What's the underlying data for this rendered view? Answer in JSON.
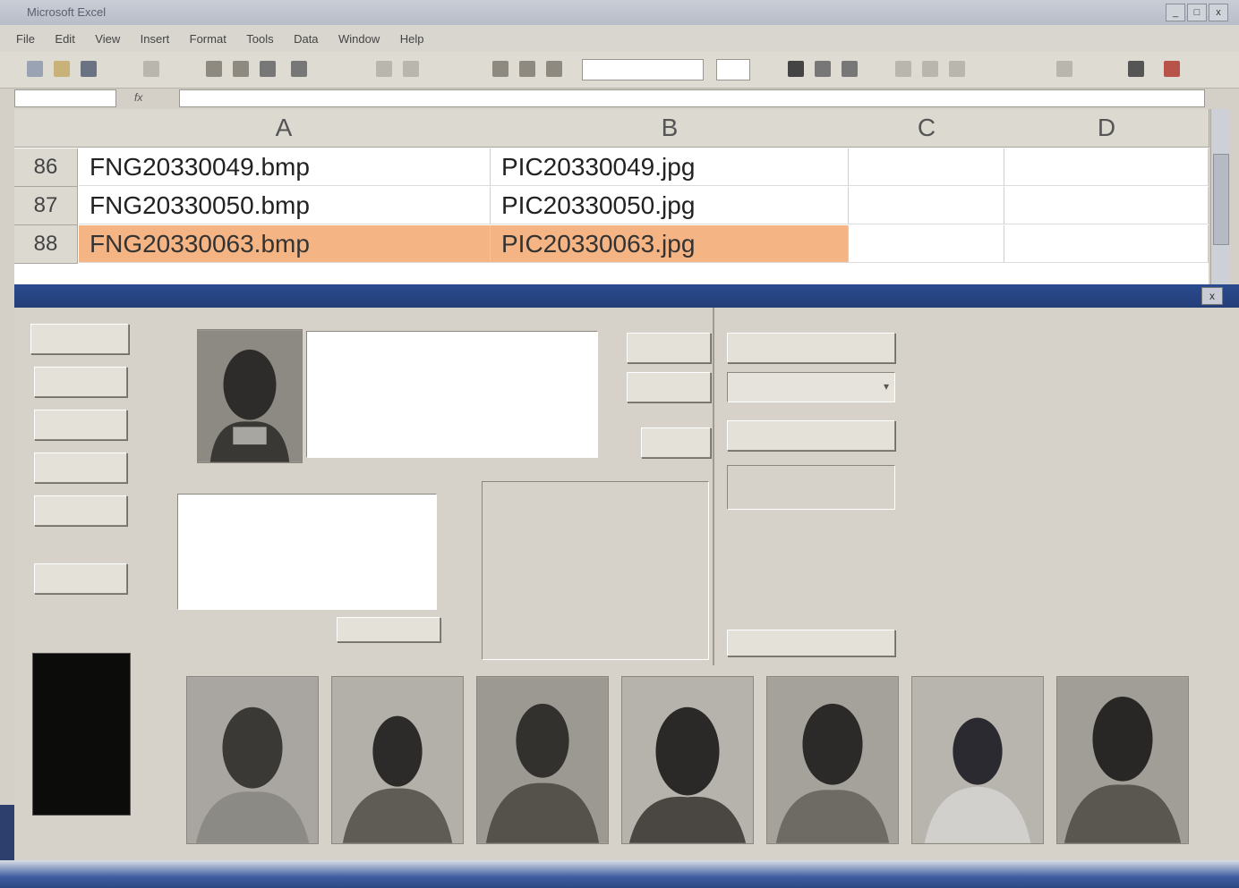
{
  "excel": {
    "window_title": "Microsoft Excel",
    "menu": [
      "File",
      "Edit",
      "View",
      "Insert",
      "Format",
      "Tools",
      "Data",
      "Window",
      "Help"
    ],
    "font_name": "",
    "font_size": "",
    "name_box": "",
    "fx": "fx",
    "formula": "",
    "columns": [
      "A",
      "B",
      "C",
      "D"
    ],
    "rows": [
      {
        "num": "86",
        "a": "FNG20330049.bmp",
        "b": "PIC20330049.jpg",
        "highlight": false
      },
      {
        "num": "87",
        "a": "FNG20330050.bmp",
        "b": "PIC20330050.jpg",
        "highlight": false
      },
      {
        "num": "88",
        "a": "FNG20330063.bmp",
        "b": "PIC20330063.jpg",
        "highlight": true
      }
    ],
    "highlight_color": "#f4b483"
  },
  "app": {
    "window_title": "",
    "close_label": "x",
    "left_buttons": [
      "",
      "",
      "",
      "",
      "",
      ""
    ],
    "top_buttons": [
      "",
      "",
      ""
    ],
    "right_buttons": [
      "",
      "",
      ""
    ],
    "small_label": "",
    "list_first_item": "",
    "bottom_label": "",
    "bottom_button": "",
    "bottom_right_button": "",
    "info_panel_lines": [
      "",
      "",
      ""
    ],
    "thumbnail_count": 7,
    "title_bar_color": "#2a4b8f"
  }
}
